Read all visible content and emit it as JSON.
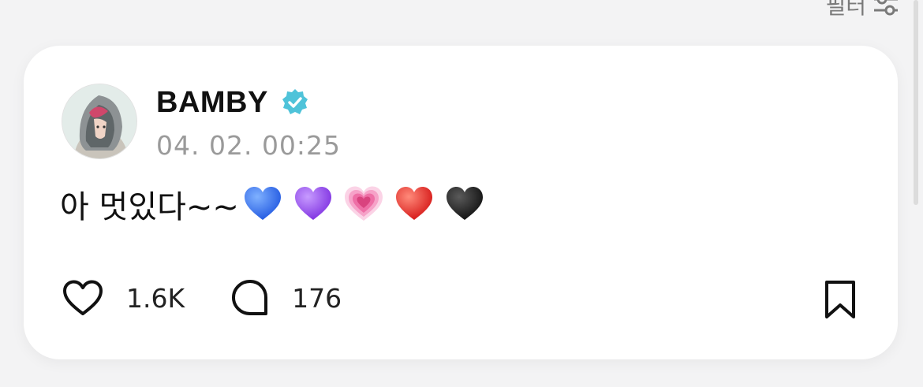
{
  "top_hint": {
    "label": "필터",
    "icon": "sliders-icon"
  },
  "post": {
    "author": {
      "name": "BAMBY",
      "verified": true,
      "verified_icon": "verified-badge-icon",
      "verified_color": "#4fc3d9",
      "avatar": "avatar-hooded-character"
    },
    "timestamp": "04. 02. 00:25",
    "text": "아 멋있다~~",
    "emojis": [
      {
        "name": "blue-heart-emoji",
        "color": "#2f6df6"
      },
      {
        "name": "purple-heart-emoji",
        "color": "#9b4df0"
      },
      {
        "name": "heart-pulse-emoji",
        "color": "#f27fb6"
      },
      {
        "name": "red-heart-emoji",
        "color": "#e02424"
      },
      {
        "name": "black-heart-emoji",
        "color": "#161616"
      }
    ],
    "actions": {
      "like": {
        "icon": "heart-outline-icon",
        "count": "1.6K"
      },
      "comment": {
        "icon": "comment-bubble-icon",
        "count": "176"
      },
      "bookmark": {
        "icon": "bookmark-outline-icon"
      }
    }
  }
}
